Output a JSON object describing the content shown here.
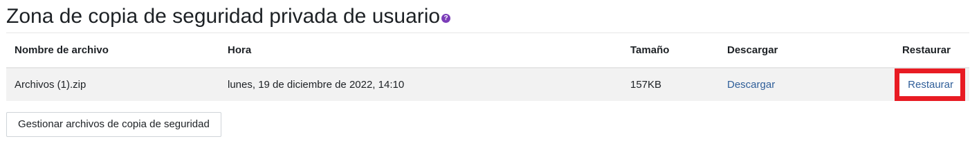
{
  "page": {
    "title": "Zona de copia de seguridad privada de usuario",
    "help_icon": "question-circle-icon"
  },
  "table": {
    "headers": {
      "filename": "Nombre de archivo",
      "time": "Hora",
      "size": "Tamaño",
      "download": "Descargar",
      "restore": "Restaurar"
    },
    "rows": [
      {
        "filename": "Archivos (1).zip",
        "time": "lunes, 19 de diciembre de 2022, 14:10",
        "size": "157KB",
        "download": "Descargar",
        "restore": "Restaurar"
      }
    ]
  },
  "actions": {
    "manage_label": "Gestionar archivos de copia de seguridad"
  },
  "colors": {
    "link": "#2f5e99",
    "highlight": "#e81b23",
    "help_icon": "#7b3db8",
    "row_background": "#f2f2f2"
  }
}
